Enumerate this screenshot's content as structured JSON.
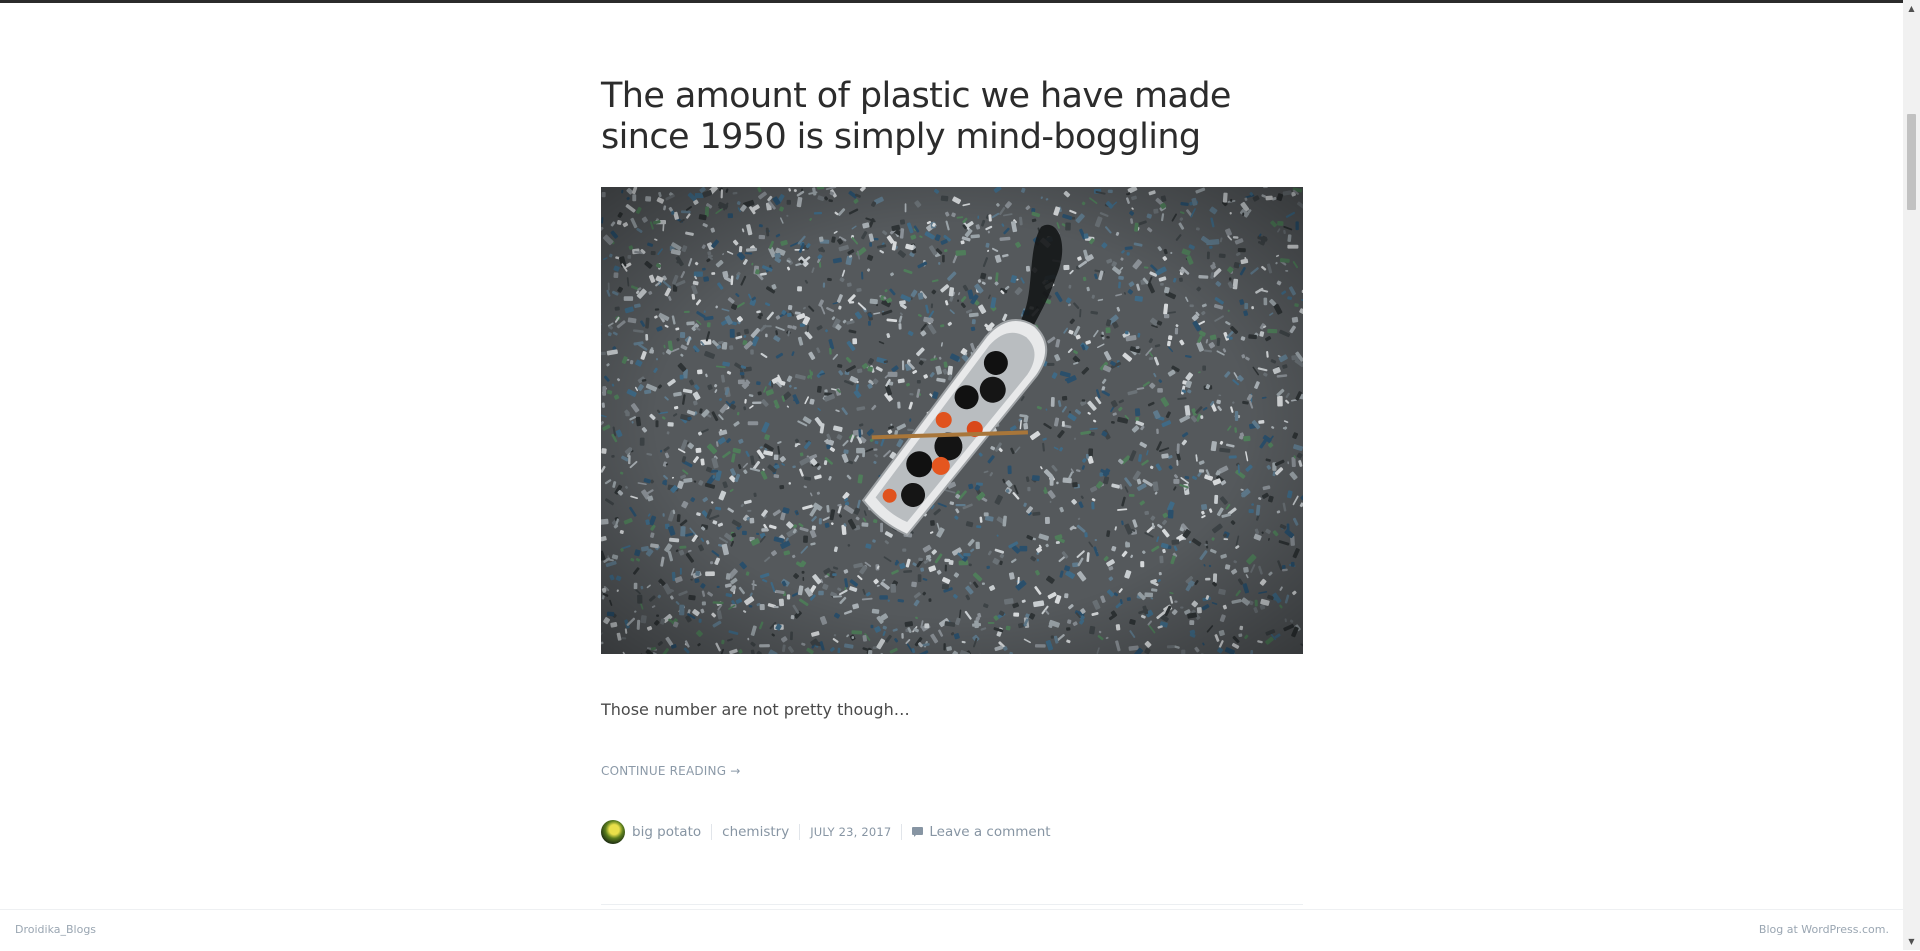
{
  "post": {
    "title": "The amount of plastic we have made since 1950 is simply mind-boggling",
    "excerpt": "Those number are not pretty though…",
    "continue_label": "CONTINUE READING →",
    "meta": {
      "author": "big potato",
      "category": "chemistry",
      "date": "JULY 23, 2017",
      "comments_label": "Leave a comment"
    }
  },
  "footer": {
    "site_name": "Droidika_Blogs",
    "credit": "Blog at WordPress.com."
  },
  "colors": {
    "title": "#2c2c2c",
    "meta": "#8795a3",
    "link": "#8c9aa8",
    "top_rule": "#2b2b2b"
  },
  "icons": {
    "comment": "comment-bubble-icon",
    "scroll_up": "triangle-up",
    "scroll_down": "triangle-down"
  }
}
